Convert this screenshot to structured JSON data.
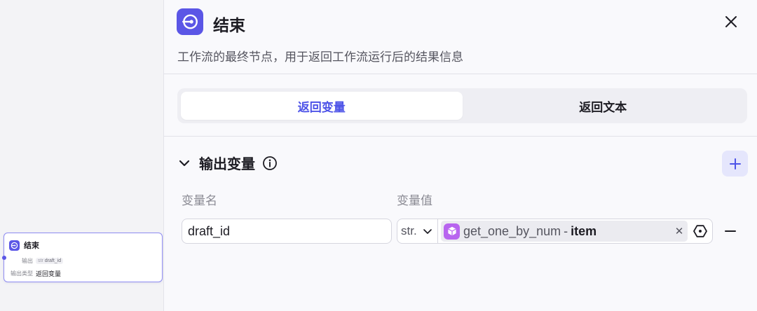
{
  "colors": {
    "accent": "#4d53e8",
    "node_badge": "#5b56e6",
    "ref_icon": "#b865ef"
  },
  "canvas": {
    "node": {
      "title": "结束",
      "output_label": "输出",
      "output_type": "str",
      "output_name": "draft_id",
      "output_kind_label": "输出类型",
      "output_kind_value": "返回变量"
    }
  },
  "panel": {
    "title": "结束",
    "description": "工作流的最终节点，用于返回工作流运行后的结果信息",
    "tabs": [
      {
        "label": "返回变量",
        "active": true
      },
      {
        "label": "返回文本",
        "active": false
      }
    ],
    "section": {
      "title": "输出变量",
      "columns": {
        "name": "变量名",
        "value": "变量值"
      },
      "rows": [
        {
          "name": "draft_id",
          "type": "str.",
          "ref_node": "get_one_by_num",
          "ref_sep": "-",
          "ref_field": "item"
        }
      ]
    }
  },
  "icons": {
    "node_badge": "end-node-icon",
    "close": "close-icon",
    "collapse": "chevron-down-icon",
    "info": "info-icon",
    "add": "plus-icon",
    "type_dropdown": "chevron-down-icon",
    "ref": "cube-icon",
    "clear": "clear-icon",
    "variable": "variable-picker-icon",
    "remove": "minus-icon"
  }
}
